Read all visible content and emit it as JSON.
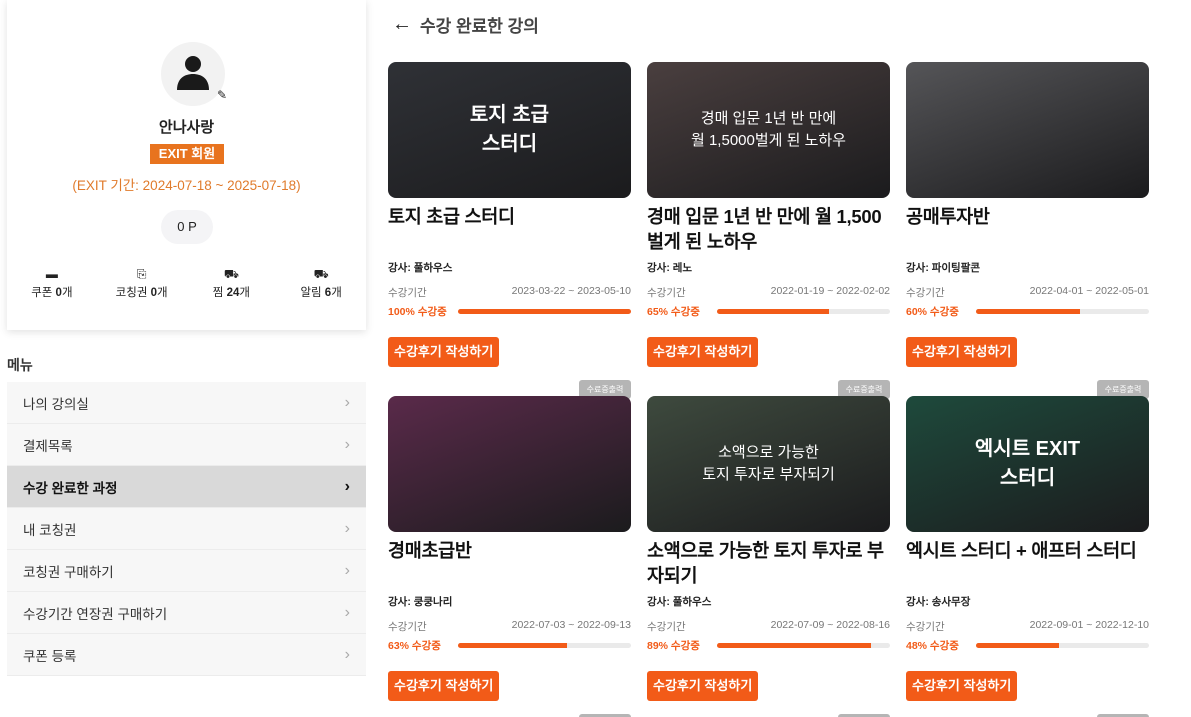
{
  "profile": {
    "name": "안나사랑",
    "badge": "EXIT 회원",
    "exit_period": "(EXIT 기간: 2024-07-18 ~ 2025-07-18)",
    "points": "0 P",
    "stats": [
      {
        "icon": "ticket-icon",
        "label": "쿠폰 ",
        "count": "0",
        "unit": "개"
      },
      {
        "icon": "coaching-ticket-icon",
        "label": "코칭권 ",
        "count": "0",
        "unit": "개"
      },
      {
        "icon": "basket-icon",
        "label": "찜 ",
        "count": "24",
        "unit": "개"
      },
      {
        "icon": "basket-icon",
        "label": "알림 ",
        "count": "6",
        "unit": "개"
      }
    ]
  },
  "menu": {
    "title": "메뉴",
    "items": [
      {
        "label": "나의 강의실",
        "active": false
      },
      {
        "label": "결제목록",
        "active": false
      },
      {
        "label": "수강 완료한 과정",
        "active": true
      },
      {
        "label": "내 코칭권",
        "active": false
      },
      {
        "label": "코칭권 구매하기",
        "active": false
      },
      {
        "label": "수강기간 연장권 구매하기",
        "active": false
      },
      {
        "label": "쿠폰 등록",
        "active": false
      }
    ]
  },
  "page": {
    "title": "수강 완료한 강의",
    "period_label": "수강기간",
    "review_button": "수강후기 작성하기",
    "certificate_button": "수료증출력"
  },
  "courses": [
    {
      "title": "토지 초급 스터디",
      "thumb_text": "토지 초급\n스터디",
      "instructor": "강사: 풀하우스",
      "period": "2023-03-22 ~ 2023-05-10",
      "progress_label": "100% 수강중",
      "progress": 1.0,
      "bg": "#2f3136"
    },
    {
      "title": "경매 입문 1년 반 만에 월 1,500벌게 된 노하우",
      "thumb_text": "경매 입문 1년 반 만에\n월 1,5000벌게 된 노하우",
      "instructor": "강사: 레노",
      "period": "2022-01-19 ~ 2022-02-02",
      "progress_label": "65% 수강중",
      "progress": 0.65,
      "bg": "#4a3f3f"
    },
    {
      "title": "공매투자반",
      "thumb_text": "",
      "instructor": "강사: 파이팅팔콘",
      "period": "2022-04-01 ~ 2022-05-01",
      "progress_label": "60% 수강중",
      "progress": 0.6,
      "bg": "#555558"
    },
    {
      "title": "경매초급반",
      "thumb_text": "",
      "instructor": "강사: 쿵쿵나리",
      "period": "2022-07-03 ~ 2022-09-13",
      "progress_label": "63% 수강중",
      "progress": 0.63,
      "bg": "#5a2a4a"
    },
    {
      "title": "소액으로 가능한 토지 투자로 부자되기",
      "thumb_text": "소액으로 가능한\n토지 투자로 부자되기",
      "instructor": "강사: 풀하우스",
      "period": "2022-07-09 ~ 2022-08-16",
      "progress_label": "89% 수강중",
      "progress": 0.89,
      "bg": "#3e4a3e"
    },
    {
      "title": "엑시트 스터디 + 애프터 스터디",
      "thumb_text": "엑시트 EXIT\n스터디",
      "instructor": "강사: 송사무장",
      "period": "2022-09-01 ~ 2022-12-10",
      "progress_label": "48% 수강중",
      "progress": 0.48,
      "bg": "#1e4a3c"
    }
  ]
}
